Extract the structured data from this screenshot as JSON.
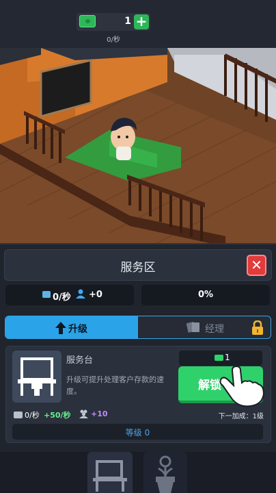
{
  "hud": {
    "money": "1",
    "rate": "0/秒",
    "icons": {
      "cash": "cash-icon",
      "add": "plus-icon"
    }
  },
  "panel": {
    "title": "服务区",
    "close_icon": "close-x-icon",
    "stats": {
      "income_rate": "0/秒",
      "customers": "+0",
      "percent": "0%"
    },
    "tabs": [
      {
        "label": "升级",
        "icon": "arrow-up-icon",
        "active": true
      },
      {
        "label": "经理",
        "icon": "cards-icon",
        "locked": true
      }
    ],
    "item": {
      "name": "服务台",
      "description": "升级可提升处理客户存款的速度。",
      "unlock_cost": "1",
      "unlock_label": "解锁",
      "income_rate": "0/秒",
      "income_plus": "+50/秒",
      "customers_plus": "+10",
      "next_bonus": "下一加成：1级",
      "level": "等级 0"
    }
  },
  "colors": {
    "accent_blue": "#2aa3e8",
    "green": "#2fd16b",
    "red": "#e23b3b",
    "purple": "#c28cff",
    "bg_dark": "#20242d"
  }
}
